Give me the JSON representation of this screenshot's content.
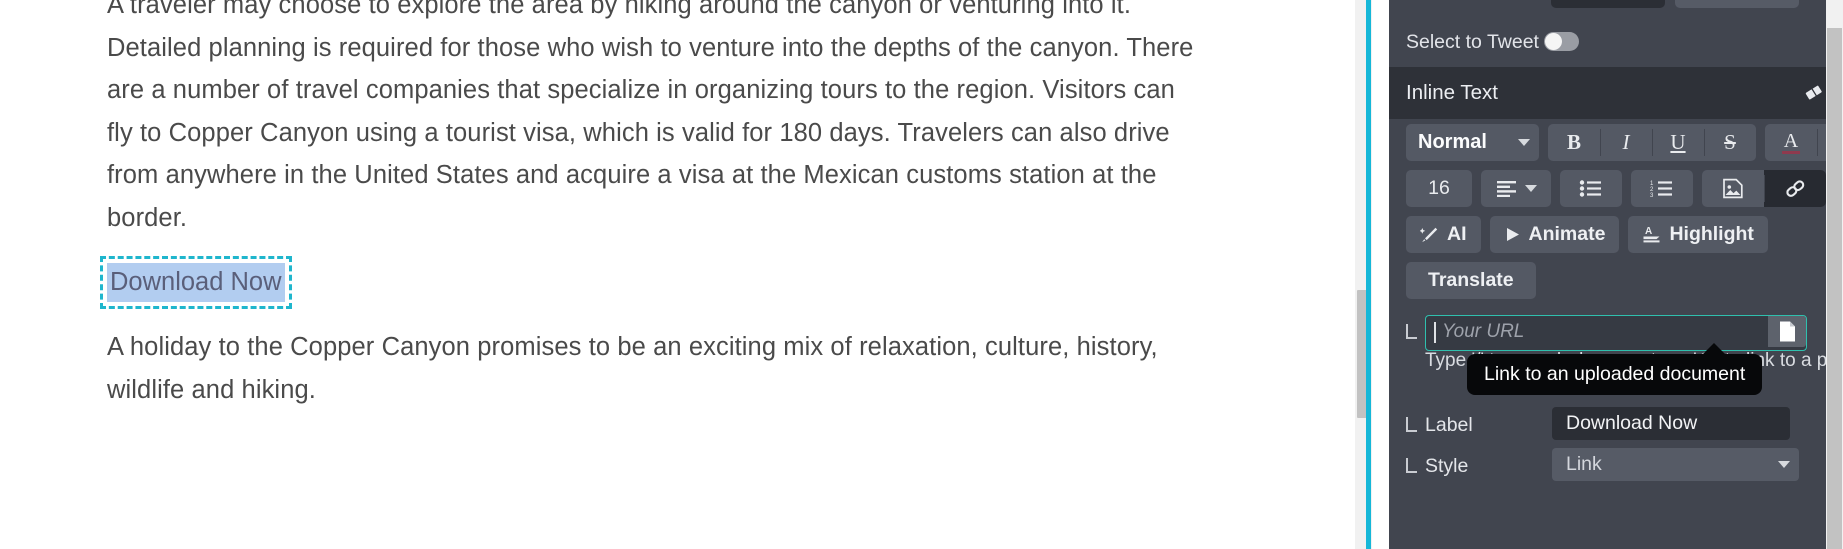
{
  "editor": {
    "paragraphs": [
      "A traveler may choose to explore the area by hiking around the canyon or venturing into it. Detailed planning is required for those who wish to venture into the depths of the canyon. There are a number of travel companies that specialize in organizing tours to the region. Visitors can fly to Copper Canyon using a tourist visa, which is valid for 180 days. Travelers can also drive from anywhere in the United States and acquire a visa at the Mexican customs station at the border.",
      "A holiday to the Copper Canyon promises to be an exciting mix of relaxation, culture, history, wildlife and hiking."
    ],
    "link_text": "Download Now",
    "selection_color": "#b2cdf0",
    "selection_frame_color": "#1fb6cd"
  },
  "divider": {
    "color": "#16b7d8"
  },
  "panel": {
    "tweet_row": {
      "label": "Select to Tweet",
      "toggle_state": "off"
    },
    "section": {
      "title": "Inline Text",
      "clear_icon": "eraser-icon"
    },
    "toolbar": {
      "block_style": "Normal",
      "bold": "B",
      "italic": "I",
      "underline": "U",
      "strikethrough": "S",
      "font_color_icon": "text-color-icon",
      "highlight_color_icon": "paint-brush-icon",
      "font_size": "16",
      "align_icon": "align-left-icon",
      "bullet_list_icon": "bullet-list-icon",
      "numbered_list_icon": "numbered-list-icon",
      "insert_image_icon": "image-icon",
      "insert_link_icon": "link-icon",
      "ai": "AI",
      "animate": "Animate",
      "highlight": "Highlight",
      "translate": "Translate"
    },
    "url_field": {
      "value": "",
      "placeholder": "Your URL",
      "document_button_icon": "document-icon",
      "border_color": "#2fc0ae"
    },
    "hint": "Type '/' to search documents or '@' to link to a page",
    "tooltip": "Link to an uploaded document",
    "label_row": {
      "label": "Label",
      "value": "Download Now"
    },
    "style_row": {
      "label": "Style",
      "value": "Link"
    }
  }
}
